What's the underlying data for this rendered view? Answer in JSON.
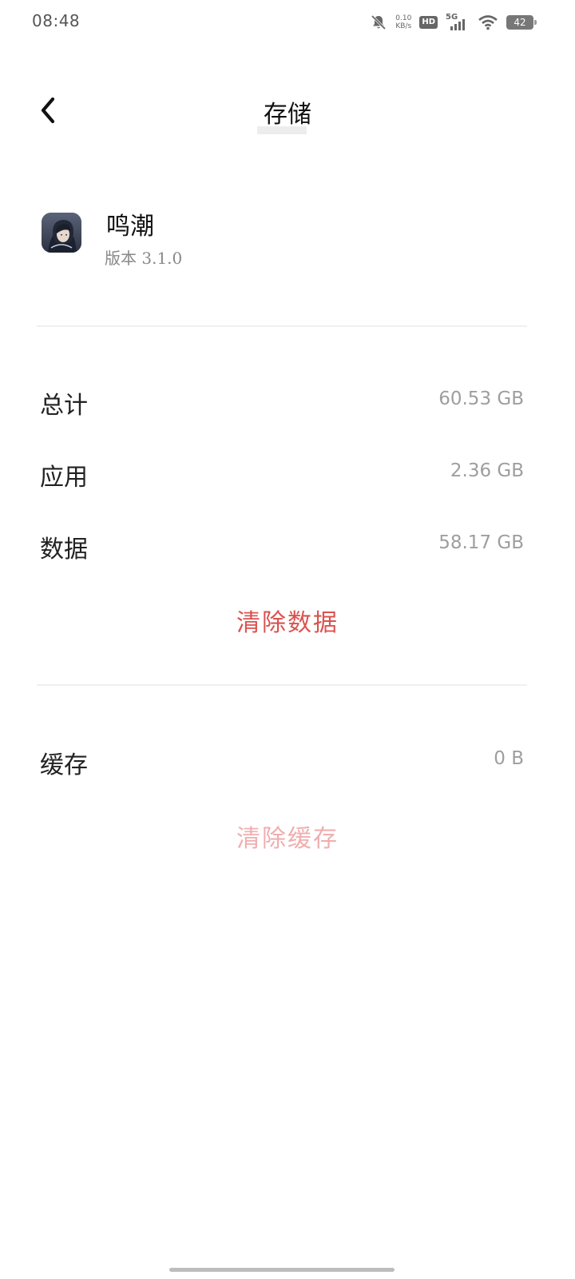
{
  "status_bar": {
    "time": "08:48",
    "net_speed_value": "0.10",
    "net_speed_unit": "KB/s",
    "hd_label": "HD",
    "network_label": "5G",
    "battery_level": "42"
  },
  "header": {
    "title": "存储"
  },
  "app": {
    "name": "鸣潮",
    "version": "版本 3.1.0"
  },
  "storage": {
    "total_label": "总计",
    "total_value": "60.53 GB",
    "app_label": "应用",
    "app_value": "2.36 GB",
    "data_label": "数据",
    "data_value": "58.17 GB",
    "clear_data_label": "清除数据"
  },
  "cache": {
    "label": "缓存",
    "value": "0 B",
    "clear_cache_label": "清除缓存"
  },
  "colors": {
    "accent_red": "#d9534f",
    "disabled_red": "#f0aeb0",
    "value_gray": "#9e9e9e"
  },
  "icons": {
    "back": "chevron-left-icon",
    "mute": "bell-off-icon",
    "signal": "cellular-signal-icon",
    "wifi": "wifi-icon",
    "battery": "battery-icon"
  }
}
